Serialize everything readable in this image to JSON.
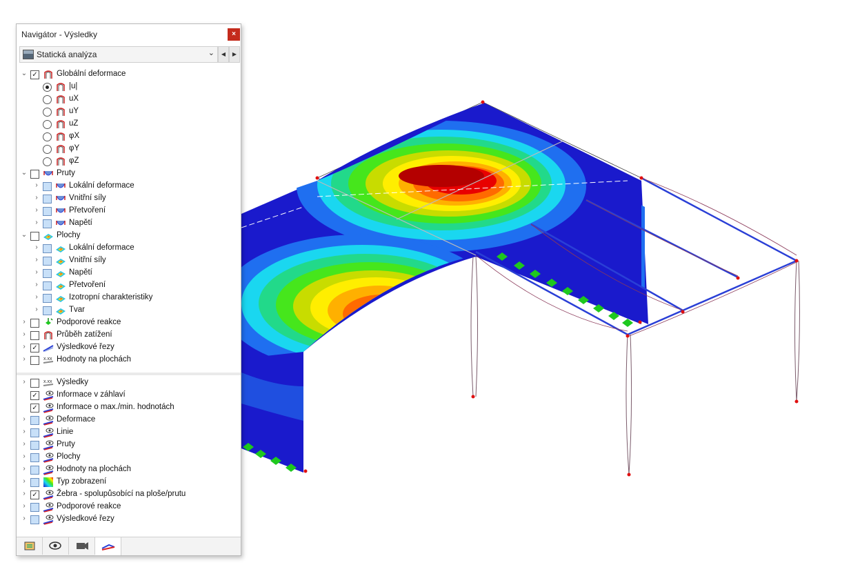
{
  "window": {
    "title": "Navigátor - Výsledky",
    "close_glyph": "×"
  },
  "dropdown": {
    "value": "Statická analýza",
    "arrow": "⌄",
    "prev": "◀",
    "next": "▶"
  },
  "tree": [
    {
      "label": "Globální deformace",
      "level": 0,
      "ctl": "check",
      "state": "checked",
      "chev": "open",
      "icon": "deformation-icon"
    },
    {
      "label": "|u|",
      "level": 1,
      "ctl": "radio",
      "state": "on",
      "chev": "none",
      "icon": "deformation-icon"
    },
    {
      "label": "uX",
      "level": 1,
      "ctl": "radio",
      "state": "off",
      "chev": "none",
      "icon": "deformation-icon"
    },
    {
      "label": "uY",
      "level": 1,
      "ctl": "radio",
      "state": "off",
      "chev": "none",
      "icon": "deformation-icon"
    },
    {
      "label": "uZ",
      "level": 1,
      "ctl": "radio",
      "state": "off",
      "chev": "none",
      "icon": "deformation-icon"
    },
    {
      "label": "φX",
      "level": 1,
      "ctl": "radio",
      "state": "off",
      "chev": "none",
      "icon": "deformation-icon"
    },
    {
      "label": "φY",
      "level": 1,
      "ctl": "radio",
      "state": "off",
      "chev": "none",
      "icon": "deformation-icon"
    },
    {
      "label": "φZ",
      "level": 1,
      "ctl": "radio",
      "state": "off",
      "chev": "none",
      "icon": "deformation-icon"
    },
    {
      "label": "Pruty",
      "level": 0,
      "ctl": "check",
      "state": "off",
      "chev": "open",
      "icon": "member-icon"
    },
    {
      "label": "Lokální deformace",
      "level": 1,
      "ctl": "check",
      "state": "ind",
      "chev": "closed",
      "icon": "member-icon"
    },
    {
      "label": "Vnitřní síly",
      "level": 1,
      "ctl": "check",
      "state": "ind",
      "chev": "closed",
      "icon": "member-icon"
    },
    {
      "label": "Přetvoření",
      "level": 1,
      "ctl": "check",
      "state": "ind",
      "chev": "closed",
      "icon": "member-icon"
    },
    {
      "label": "Napětí",
      "level": 1,
      "ctl": "check",
      "state": "ind",
      "chev": "closed",
      "icon": "member-icon"
    },
    {
      "label": "Plochy",
      "level": 0,
      "ctl": "check",
      "state": "off",
      "chev": "open",
      "icon": "surface-icon"
    },
    {
      "label": "Lokální deformace",
      "level": 1,
      "ctl": "check",
      "state": "ind",
      "chev": "closed",
      "icon": "surface-icon"
    },
    {
      "label": "Vnitřní síly",
      "level": 1,
      "ctl": "check",
      "state": "ind",
      "chev": "closed",
      "icon": "surface-icon"
    },
    {
      "label": "Napětí",
      "level": 1,
      "ctl": "check",
      "state": "ind",
      "chev": "closed",
      "icon": "surface-icon"
    },
    {
      "label": "Přetvoření",
      "level": 1,
      "ctl": "check",
      "state": "ind",
      "chev": "closed",
      "icon": "surface-icon"
    },
    {
      "label": "Izotropní charakteristiky",
      "level": 1,
      "ctl": "check",
      "state": "ind",
      "chev": "closed",
      "icon": "surface-icon"
    },
    {
      "label": "Tvar",
      "level": 1,
      "ctl": "check",
      "state": "ind",
      "chev": "closed",
      "icon": "surface-icon"
    },
    {
      "label": "Podporové reakce",
      "level": 0,
      "ctl": "check",
      "state": "off",
      "chev": "closed",
      "icon": "support-icon"
    },
    {
      "label": "Průběh zatížení",
      "level": 0,
      "ctl": "check",
      "state": "off",
      "chev": "closed",
      "icon": "deformation-icon"
    },
    {
      "label": "Výsledkové řezy",
      "level": 0,
      "ctl": "check",
      "state": "checked",
      "chev": "closed",
      "icon": "section-icon"
    },
    {
      "label": "Hodnoty na plochách",
      "level": 0,
      "ctl": "check",
      "state": "off",
      "chev": "closed",
      "icon": "values-icon"
    }
  ],
  "display_tree": [
    {
      "label": "Výsledky",
      "ctl": "check",
      "state": "off",
      "chev": "closed",
      "icon": "values-icon",
      "icon_text": "x.xx"
    },
    {
      "label": "Informace v záhlaví",
      "ctl": "check",
      "state": "checked",
      "chev": "none",
      "icon": "eye-icon"
    },
    {
      "label": "Informace o max./min. hodnotách",
      "ctl": "check",
      "state": "checked",
      "chev": "none",
      "icon": "eye-icon"
    },
    {
      "label": "Deformace",
      "ctl": "check",
      "state": "ind",
      "chev": "closed",
      "icon": "eye-icon"
    },
    {
      "label": "Linie",
      "ctl": "check",
      "state": "ind",
      "chev": "closed",
      "icon": "eye-icon"
    },
    {
      "label": "Pruty",
      "ctl": "check",
      "state": "ind",
      "chev": "closed",
      "icon": "eye-icon"
    },
    {
      "label": "Plochy",
      "ctl": "check",
      "state": "ind",
      "chev": "closed",
      "icon": "eye-icon"
    },
    {
      "label": "Hodnoty na plochách",
      "ctl": "check",
      "state": "ind",
      "chev": "closed",
      "icon": "eye-icon"
    },
    {
      "label": "Typ zobrazení",
      "ctl": "check",
      "state": "ind",
      "chev": "closed",
      "icon": "color-scale-icon"
    },
    {
      "label": "Žebra - spolupůsobící na ploše/prutu",
      "ctl": "check",
      "state": "checked",
      "chev": "closed",
      "icon": "eye-icon"
    },
    {
      "label": "Podporové reakce",
      "ctl": "check",
      "state": "ind",
      "chev": "closed",
      "icon": "eye-icon"
    },
    {
      "label": "Výsledkové řezy",
      "ctl": "check",
      "state": "ind",
      "chev": "closed",
      "icon": "eye-icon"
    }
  ],
  "tabs": [
    "data-tab-icon",
    "view-tab-icon",
    "camera-tab-icon",
    "results-tab-icon"
  ],
  "colors": {
    "contour": [
      "#1a1acc",
      "#1f6ff0",
      "#1ad7f0",
      "#22d98a",
      "#46e61c",
      "#c8dc00",
      "#ffee00",
      "#ffb000",
      "#ff6a00",
      "#e80000",
      "#b40000"
    ],
    "frame": "#2a3fd6",
    "support": "#1ec81e",
    "node": "#e01010"
  }
}
